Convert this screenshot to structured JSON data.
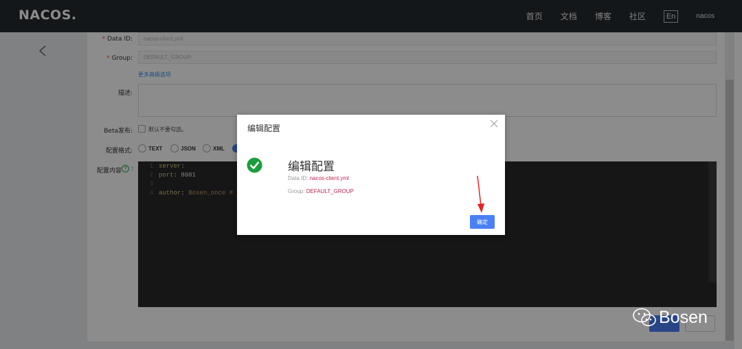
{
  "nav": {
    "logo": "NACOS.",
    "items": [
      "首页",
      "文档",
      "博客",
      "社区"
    ],
    "lang": "En",
    "user": "nacos"
  },
  "form": {
    "data_id_label": "Data ID:",
    "data_id_value": "nacos-client.yml",
    "group_label": "Group:",
    "group_value": "DEFAULT_GROUP",
    "more_options": "更多高级选项",
    "desc_label": "描述:",
    "beta_label": "Beta发布:",
    "beta_hint": "默认不要勾选。",
    "format_label": "配置格式:",
    "formats": [
      "TEXT",
      "JSON",
      "XML"
    ],
    "content_label": "配置内容",
    "help_symbol": "?",
    "colon": ":",
    "required_mark": "*"
  },
  "editor": {
    "lines": [
      {
        "num": "1",
        "key": "server",
        "sep": ":",
        "val": ""
      },
      {
        "num": "2",
        "key": "  port",
        "sep": ": ",
        "val": "8001"
      },
      {
        "num": "3",
        "key": "",
        "sep": "",
        "val": ""
      },
      {
        "num": "4",
        "key": "author",
        "sep": ": ",
        "val": "Bosen_once #"
      }
    ]
  },
  "dialog": {
    "title": "编辑配置",
    "heading": "编辑配置",
    "data_id_label": "Data ID: ",
    "data_id_value": "nacos-client.yml",
    "group_label": "Group: ",
    "group_value": "DEFAULT_GROUP",
    "ok_label": "确定"
  },
  "watermark": {
    "text": "Bosen"
  },
  "colors": {
    "topbar": "#252a2f",
    "primary": "#4a80f5",
    "success": "#1a9e3a",
    "arrow": "#e8231e"
  }
}
